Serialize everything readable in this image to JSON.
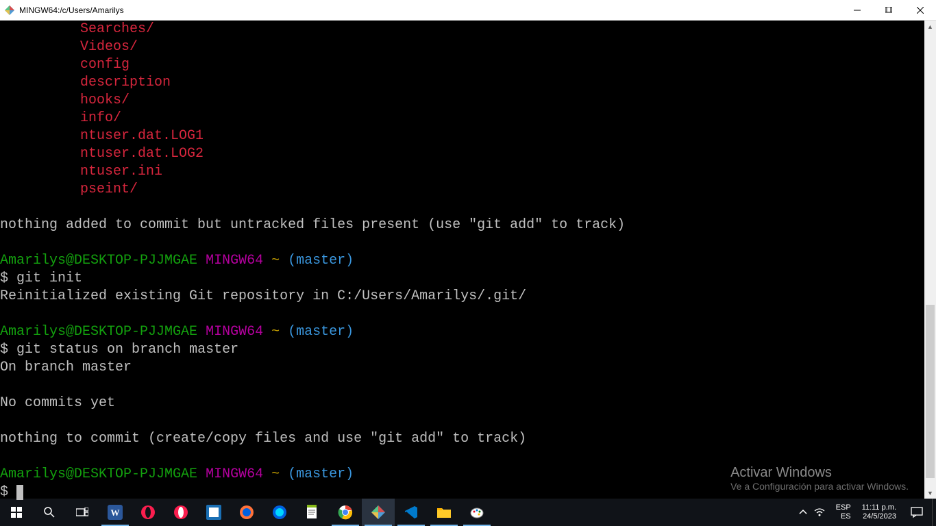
{
  "window": {
    "title": "MINGW64:/c/Users/Amarilys"
  },
  "terminal": {
    "files": [
      "Searches/",
      "Videos/",
      "config",
      "description",
      "hooks/",
      "info/",
      "ntuser.dat.LOG1",
      "ntuser.dat.LOG2",
      "ntuser.ini",
      "pseint/"
    ],
    "msg_nothing_added": "nothing added to commit but untracked files present (use \"git add\" to track)",
    "prompt_user": "Amarilys@DESKTOP-PJJMGAE",
    "prompt_sys": "MINGW64",
    "prompt_path": "~",
    "prompt_branch": "(master)",
    "ps": "$",
    "cmd1": "git init",
    "out1": "Reinitialized existing Git repository in C:/Users/Amarilys/.git/",
    "cmd2": "git status on branch master",
    "out2a": "On branch master",
    "out2b": "No commits yet",
    "out2c": "nothing to commit (create/copy files and use \"git add\" to track)"
  },
  "watermark": {
    "line1": "Activar Windows",
    "line2": "Ve a Configuración para activar Windows."
  },
  "tray": {
    "lang_top": "ESP",
    "lang_bot": "ES",
    "time": "11:11 p.m.",
    "date": "24/5/2023"
  }
}
